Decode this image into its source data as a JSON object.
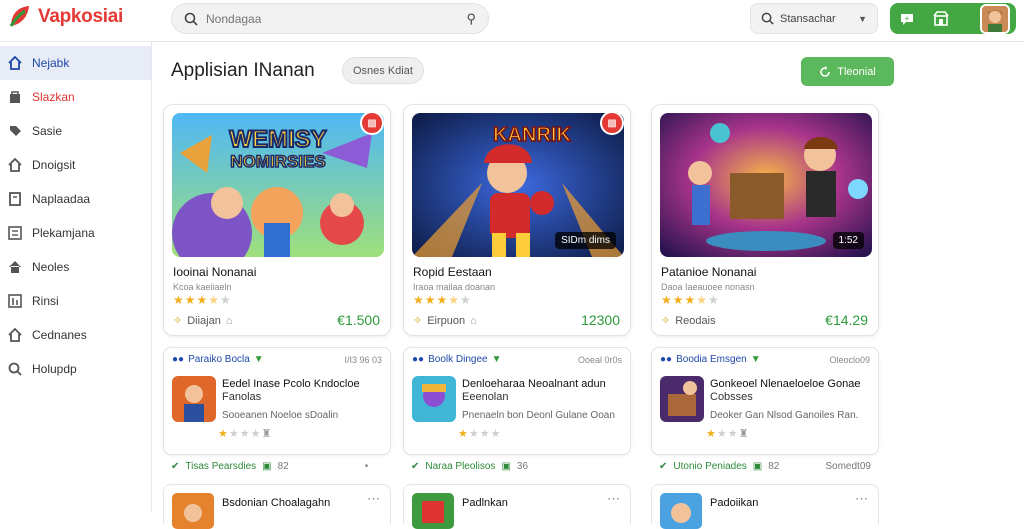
{
  "app": {
    "name": "Vapkosiai"
  },
  "search": {
    "placeholder": "Nondagaa",
    "value": ""
  },
  "search2": {
    "label": "Stansachar"
  },
  "header": {
    "title": "Applisian INanan",
    "pill": "Osnes Kdiat",
    "install_label": "Tleonial"
  },
  "sidebar": {
    "items": [
      {
        "label": "Nejabk",
        "icon": "home-icon"
      },
      {
        "label": "Slazkan",
        "icon": "store-icon"
      },
      {
        "label": "Sasie",
        "icon": "tag-icon"
      },
      {
        "label": "Dnoigsit",
        "icon": "gift-icon"
      },
      {
        "label": "Naplaadaa",
        "icon": "bookmark-icon"
      },
      {
        "label": "Plekamjana",
        "icon": "list-icon"
      },
      {
        "label": "Neoles",
        "icon": "bag-icon"
      },
      {
        "label": "Rinsi",
        "icon": "chart-icon"
      },
      {
        "label": "Cednanes",
        "icon": "settings-icon"
      },
      {
        "label": "Holupdp",
        "icon": "search-icon"
      }
    ]
  },
  "featured": [
    {
      "art_title_1": "WEMISY",
      "art_title_2": "NOMIRSIES",
      "name": "Iooinai Nonanai",
      "sub": "Kcoa kaeiiaeln",
      "rating": 3.5,
      "dev": "Diiajan",
      "price": "€1.500",
      "tag": ""
    },
    {
      "art_title_1": "KANRIK",
      "art_title_2": "",
      "name": "Ropid Eestaan",
      "sub": "Iraoa mailaa doanan",
      "rating": 3.5,
      "dev": "Eirpuon",
      "price": "12300",
      "tag": "SIDm dims"
    },
    {
      "art_title_1": "",
      "art_title_2": "",
      "name": "Patanioe Nonanai",
      "sub": "Daoa Iaeauoee nonasn",
      "rating": 3.5,
      "dev": "Reodais",
      "price": "€14.29",
      "tag": "1:52"
    }
  ],
  "list_cards": [
    {
      "header": "Paraiko Bocla",
      "meta": "I/I3 96 03",
      "title": "Eedel Inase Pcolo Kndocloe",
      "title_2": "Fanolas",
      "desc": "Sooeanen Noeloe sDoalin",
      "rating": 1.5,
      "foot_label": "Tisas Pearsdies",
      "foot_num": "82"
    },
    {
      "header": "Boolk Dingee",
      "meta": "Ooeal 0r0s",
      "title": "Denloeharaa Neoalnant adun",
      "title_2": "Eeenolan",
      "desc": "Pnenaeln bon Deonl Gulane Ooan",
      "rating": 1.0,
      "foot_label": "Naraa Pleolisos",
      "foot_num": "36"
    },
    {
      "header": "Boodia Emsgen",
      "meta": "Oleoclo09",
      "title": "Gonkeoel Nlenaeloeloe Gonae",
      "title_2": "Cobsses",
      "desc": "Deoker Gan Nlsod Ganoiles Ran.",
      "rating": 1.0,
      "foot_label": "Utonio Peniades",
      "foot_num": "82"
    }
  ],
  "list_foot_meta": [
    "",
    "",
    "Somedt09"
  ],
  "bottom_cards": [
    {
      "title": "Bsdonian Choalagahn"
    },
    {
      "title": "Padlnkan"
    },
    {
      "title": "Padoiikan"
    }
  ],
  "colors": {
    "brand": "#e53935",
    "accent": "#43a843",
    "active_nav": "#1f47a8",
    "price": "#2e9a3a"
  }
}
